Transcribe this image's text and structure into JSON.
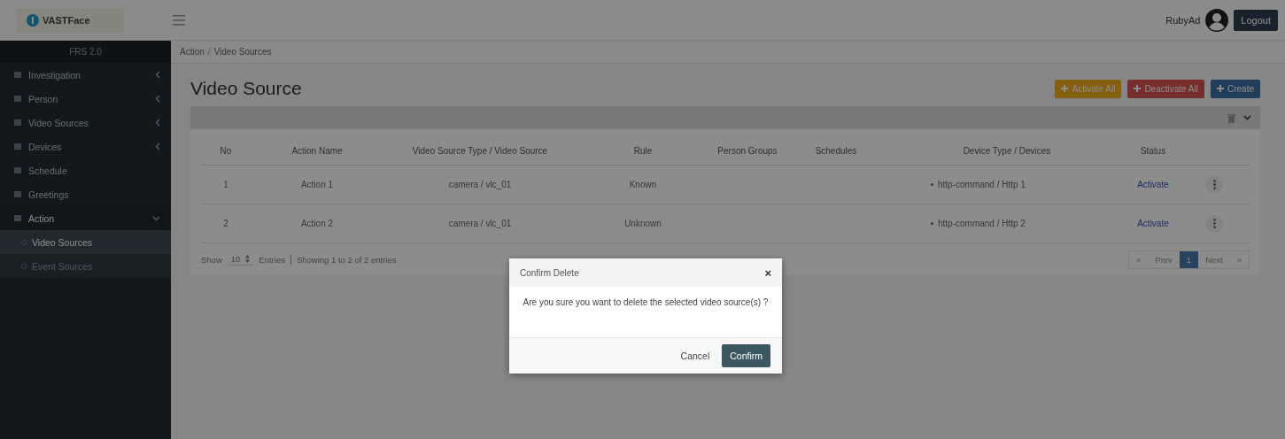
{
  "header": {
    "logo": "VASTFace",
    "user": "RubyAd",
    "logout": "Logout"
  },
  "sidebar": {
    "title": "FRS 2.0",
    "items": [
      {
        "label": "Investigation",
        "kind": "group",
        "expanded": false
      },
      {
        "label": "Person",
        "kind": "group",
        "expanded": false
      },
      {
        "label": "Video Sources",
        "kind": "group",
        "expanded": false
      },
      {
        "label": "Devices",
        "kind": "group",
        "expanded": false
      },
      {
        "label": "Schedule",
        "kind": "link"
      },
      {
        "label": "Greetings",
        "kind": "link"
      },
      {
        "label": "Action",
        "kind": "group",
        "expanded": true,
        "children": [
          {
            "label": "Video Sources",
            "selected": true
          },
          {
            "label": "Event Sources",
            "selected": false
          }
        ]
      }
    ]
  },
  "breadcrumb": {
    "separator": "/",
    "items": [
      "Action",
      "Video Sources"
    ]
  },
  "page_title": "Video Source",
  "actions": [
    {
      "label": "Activate All",
      "kind": "warning"
    },
    {
      "label": "Deactivate All",
      "kind": "danger"
    },
    {
      "label": "Create",
      "kind": "primary"
    }
  ],
  "table": {
    "columns": [
      "No",
      "Action Name",
      "Video Source Type / Video Source",
      "Rule",
      "Person Groups",
      "Schedules",
      "Device Type / Devices",
      "Status"
    ],
    "rows": [
      {
        "no": "1",
        "action_name": "Action 1",
        "video_source": "camera  /  vlc_01",
        "rule": "Known",
        "device": "http-command  /  Http 1",
        "status": "Activate"
      },
      {
        "no": "2",
        "action_name": "Action 2",
        "video_source": "camera  /  vlc_01",
        "rule": "Unknown",
        "device": "http-command  /  Http 2",
        "status": "Activate"
      }
    ]
  },
  "footer": {
    "show": "Show",
    "page_size": "10",
    "entries": "Entries",
    "summary": "Showing 1 to 2 of 2 entries"
  },
  "pagination": [
    {
      "label": "«",
      "selected": false
    },
    {
      "label": "Prev",
      "selected": false
    },
    {
      "label": "1",
      "selected": true
    },
    {
      "label": "Next",
      "selected": false
    },
    {
      "label": "»",
      "selected": false
    }
  ],
  "dialog": {
    "title": "Confirm Delete",
    "close": "×",
    "message": "Are you sure you want to delete the selected video source(s) ?",
    "cancel": "Cancel",
    "confirm": "Confirm"
  }
}
